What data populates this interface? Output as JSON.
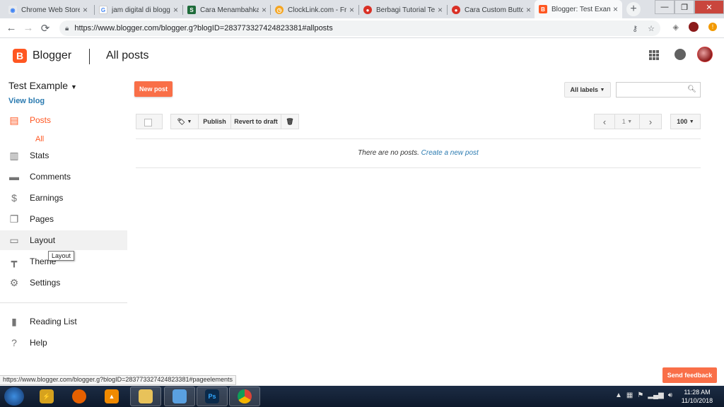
{
  "browser": {
    "tabs": [
      {
        "title": "Chrome Web Store",
        "favicon_color": "#e8eaed",
        "favicon": "chrome-icon"
      },
      {
        "title": "jam digital di blogg",
        "favicon_color": "#4285f4",
        "favicon": "google-icon"
      },
      {
        "title": "Cara Menambahka",
        "favicon_color": "#1e6b3a",
        "favicon": "s-icon"
      },
      {
        "title": "ClockLink.com - Fre",
        "favicon_color": "#f5a623",
        "favicon": "clock-icon"
      },
      {
        "title": "Berbagi Tutorial Te",
        "favicon_color": "#d93025",
        "favicon": "target-icon"
      },
      {
        "title": "Cara Custom Butto",
        "favicon_color": "#d93025",
        "favicon": "target-icon"
      },
      {
        "title": "Blogger: Test Examp",
        "favicon_color": "#ff5722",
        "favicon": "blogger-icon"
      }
    ],
    "url": "https://www.blogger.com/blogger.g?blogID=283773327424823381#allposts"
  },
  "header": {
    "brand": "Blogger",
    "page_title": "All posts",
    "logo_letter": "B"
  },
  "sidebar": {
    "blog_name": "Test Example",
    "view_blog": "View blog",
    "items": [
      {
        "label": "Posts",
        "icon": "posts-icon"
      },
      {
        "label": "Stats",
        "icon": "stats-icon"
      },
      {
        "label": "Comments",
        "icon": "comments-icon"
      },
      {
        "label": "Earnings",
        "icon": "dollar-icon"
      },
      {
        "label": "Pages",
        "icon": "pages-icon"
      },
      {
        "label": "Layout",
        "icon": "layout-icon"
      },
      {
        "label": "Theme",
        "icon": "paint-roller-icon"
      },
      {
        "label": "Settings",
        "icon": "gear-icon"
      },
      {
        "label": "Reading List",
        "icon": "bookmark-icon"
      },
      {
        "label": "Help",
        "icon": "help-icon"
      }
    ],
    "sub_item": "All",
    "tooltip": "Layout"
  },
  "main": {
    "new_post": "New post",
    "all_labels": "All labels",
    "publish": "Publish",
    "revert": "Revert to draft",
    "page_number": "1",
    "page_size": "100",
    "empty_text": "There are no posts.",
    "create_link": "Create a new post"
  },
  "feedback": "Send feedback",
  "status_url": "https://www.blogger.com/blogger.g?blogID=283773327424823381#pageelements",
  "taskbar": {
    "time": "11:28 AM",
    "date": "11/10/2018"
  },
  "colors": {
    "accent": "#ff5722",
    "link": "#2a7ab0"
  }
}
